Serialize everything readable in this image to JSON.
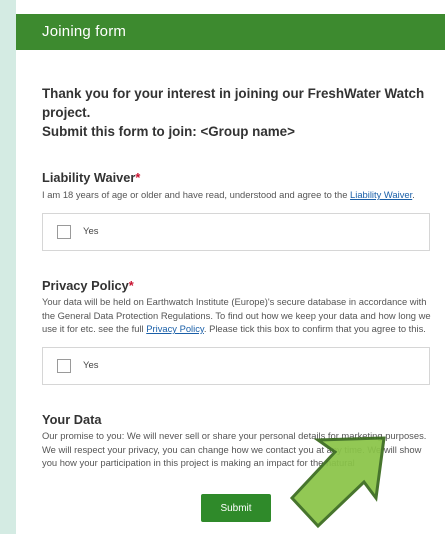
{
  "form": {
    "title": "Joining form",
    "intro": "Thank you for your interest in joining our FreshWater Watch project.\nSubmit this form to join: <Group name>",
    "required_marker": "*"
  },
  "liability": {
    "title": "Liability Waiver",
    "text_before": "I am 18 years of age or older and have read, understood and agree to the ",
    "link": "Liability Waiver",
    "text_after": ".",
    "option_label": "Yes"
  },
  "privacy": {
    "title": "Privacy Policy",
    "text_before": "Your data will be held on Earthwatch Institute (Europe)'s secure database in accordance with the General Data Protection Regulations. To find out how we keep your data and how long we use it for etc. see the full ",
    "link": "Privacy Policy",
    "text_after": ". Please tick this box to confirm that you agree to this.",
    "option_label": "Yes"
  },
  "your_data": {
    "title": "Your Data",
    "text": "Our promise to you: We will never sell or share your personal details for marketing purposes. We will respect your privacy, you can change how we contact you at any time. We will show you how your participation in this project is making an impact for the natural"
  },
  "actions": {
    "submit_label": "Submit"
  },
  "colors": {
    "header_green": "#3d8a2f",
    "button_green": "#2f8a2a",
    "arrow_fill": "#8ac448",
    "arrow_stroke": "#3a6b1e",
    "required_red": "#c8102e",
    "link_blue": "#1a5fa8"
  }
}
